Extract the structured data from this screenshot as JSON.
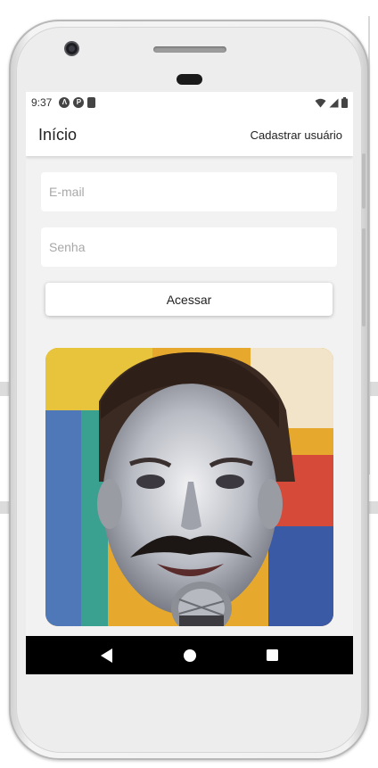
{
  "status_bar": {
    "time": "9:37",
    "left_icons": [
      "a-icon",
      "p-icon",
      "sd-card-icon"
    ],
    "right_icons": [
      "wifi-icon",
      "signal-icon",
      "battery-icon"
    ]
  },
  "app_bar": {
    "title": "Início",
    "action_label": "Cadastrar usuário"
  },
  "form": {
    "email_placeholder": "E-mail",
    "password_placeholder": "Senha",
    "submit_label": "Acessar"
  },
  "image": {
    "description_icon": "person-photo"
  },
  "nav_bar": {
    "buttons": [
      "back-icon",
      "home-icon",
      "recents-icon"
    ]
  },
  "colors": {
    "screen_bg": "#f2f2f2",
    "app_bar_bg": "#ffffff",
    "nav_bar_bg": "#000000"
  }
}
